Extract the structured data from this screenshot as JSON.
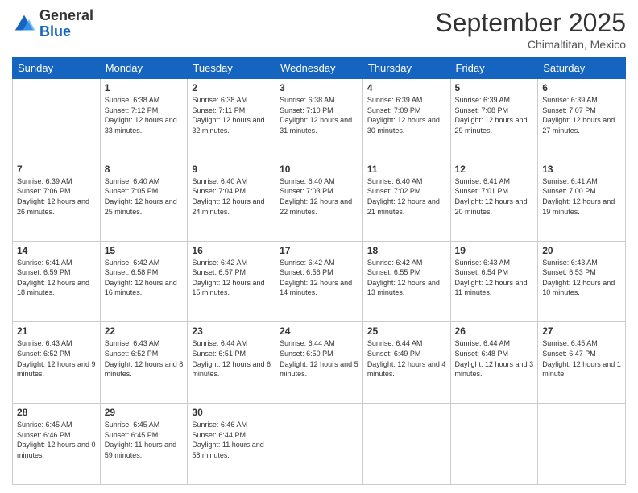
{
  "logo": {
    "general": "General",
    "blue": "Blue"
  },
  "header": {
    "month": "September 2025",
    "location": "Chimaltitan, Mexico"
  },
  "weekdays": [
    "Sunday",
    "Monday",
    "Tuesday",
    "Wednesday",
    "Thursday",
    "Friday",
    "Saturday"
  ],
  "weeks": [
    [
      {
        "day": "",
        "sunrise": "",
        "sunset": "",
        "daylight": ""
      },
      {
        "day": "1",
        "sunrise": "Sunrise: 6:38 AM",
        "sunset": "Sunset: 7:12 PM",
        "daylight": "Daylight: 12 hours and 33 minutes."
      },
      {
        "day": "2",
        "sunrise": "Sunrise: 6:38 AM",
        "sunset": "Sunset: 7:11 PM",
        "daylight": "Daylight: 12 hours and 32 minutes."
      },
      {
        "day": "3",
        "sunrise": "Sunrise: 6:38 AM",
        "sunset": "Sunset: 7:10 PM",
        "daylight": "Daylight: 12 hours and 31 minutes."
      },
      {
        "day": "4",
        "sunrise": "Sunrise: 6:39 AM",
        "sunset": "Sunset: 7:09 PM",
        "daylight": "Daylight: 12 hours and 30 minutes."
      },
      {
        "day": "5",
        "sunrise": "Sunrise: 6:39 AM",
        "sunset": "Sunset: 7:08 PM",
        "daylight": "Daylight: 12 hours and 29 minutes."
      },
      {
        "day": "6",
        "sunrise": "Sunrise: 6:39 AM",
        "sunset": "Sunset: 7:07 PM",
        "daylight": "Daylight: 12 hours and 27 minutes."
      }
    ],
    [
      {
        "day": "7",
        "sunrise": "Sunrise: 6:39 AM",
        "sunset": "Sunset: 7:06 PM",
        "daylight": "Daylight: 12 hours and 26 minutes."
      },
      {
        "day": "8",
        "sunrise": "Sunrise: 6:40 AM",
        "sunset": "Sunset: 7:05 PM",
        "daylight": "Daylight: 12 hours and 25 minutes."
      },
      {
        "day": "9",
        "sunrise": "Sunrise: 6:40 AM",
        "sunset": "Sunset: 7:04 PM",
        "daylight": "Daylight: 12 hours and 24 minutes."
      },
      {
        "day": "10",
        "sunrise": "Sunrise: 6:40 AM",
        "sunset": "Sunset: 7:03 PM",
        "daylight": "Daylight: 12 hours and 22 minutes."
      },
      {
        "day": "11",
        "sunrise": "Sunrise: 6:40 AM",
        "sunset": "Sunset: 7:02 PM",
        "daylight": "Daylight: 12 hours and 21 minutes."
      },
      {
        "day": "12",
        "sunrise": "Sunrise: 6:41 AM",
        "sunset": "Sunset: 7:01 PM",
        "daylight": "Daylight: 12 hours and 20 minutes."
      },
      {
        "day": "13",
        "sunrise": "Sunrise: 6:41 AM",
        "sunset": "Sunset: 7:00 PM",
        "daylight": "Daylight: 12 hours and 19 minutes."
      }
    ],
    [
      {
        "day": "14",
        "sunrise": "Sunrise: 6:41 AM",
        "sunset": "Sunset: 6:59 PM",
        "daylight": "Daylight: 12 hours and 18 minutes."
      },
      {
        "day": "15",
        "sunrise": "Sunrise: 6:42 AM",
        "sunset": "Sunset: 6:58 PM",
        "daylight": "Daylight: 12 hours and 16 minutes."
      },
      {
        "day": "16",
        "sunrise": "Sunrise: 6:42 AM",
        "sunset": "Sunset: 6:57 PM",
        "daylight": "Daylight: 12 hours and 15 minutes."
      },
      {
        "day": "17",
        "sunrise": "Sunrise: 6:42 AM",
        "sunset": "Sunset: 6:56 PM",
        "daylight": "Daylight: 12 hours and 14 minutes."
      },
      {
        "day": "18",
        "sunrise": "Sunrise: 6:42 AM",
        "sunset": "Sunset: 6:55 PM",
        "daylight": "Daylight: 12 hours and 13 minutes."
      },
      {
        "day": "19",
        "sunrise": "Sunrise: 6:43 AM",
        "sunset": "Sunset: 6:54 PM",
        "daylight": "Daylight: 12 hours and 11 minutes."
      },
      {
        "day": "20",
        "sunrise": "Sunrise: 6:43 AM",
        "sunset": "Sunset: 6:53 PM",
        "daylight": "Daylight: 12 hours and 10 minutes."
      }
    ],
    [
      {
        "day": "21",
        "sunrise": "Sunrise: 6:43 AM",
        "sunset": "Sunset: 6:52 PM",
        "daylight": "Daylight: 12 hours and 9 minutes."
      },
      {
        "day": "22",
        "sunrise": "Sunrise: 6:43 AM",
        "sunset": "Sunset: 6:52 PM",
        "daylight": "Daylight: 12 hours and 8 minutes."
      },
      {
        "day": "23",
        "sunrise": "Sunrise: 6:44 AM",
        "sunset": "Sunset: 6:51 PM",
        "daylight": "Daylight: 12 hours and 6 minutes."
      },
      {
        "day": "24",
        "sunrise": "Sunrise: 6:44 AM",
        "sunset": "Sunset: 6:50 PM",
        "daylight": "Daylight: 12 hours and 5 minutes."
      },
      {
        "day": "25",
        "sunrise": "Sunrise: 6:44 AM",
        "sunset": "Sunset: 6:49 PM",
        "daylight": "Daylight: 12 hours and 4 minutes."
      },
      {
        "day": "26",
        "sunrise": "Sunrise: 6:44 AM",
        "sunset": "Sunset: 6:48 PM",
        "daylight": "Daylight: 12 hours and 3 minutes."
      },
      {
        "day": "27",
        "sunrise": "Sunrise: 6:45 AM",
        "sunset": "Sunset: 6:47 PM",
        "daylight": "Daylight: 12 hours and 1 minute."
      }
    ],
    [
      {
        "day": "28",
        "sunrise": "Sunrise: 6:45 AM",
        "sunset": "Sunset: 6:46 PM",
        "daylight": "Daylight: 12 hours and 0 minutes."
      },
      {
        "day": "29",
        "sunrise": "Sunrise: 6:45 AM",
        "sunset": "Sunset: 6:45 PM",
        "daylight": "Daylight: 11 hours and 59 minutes."
      },
      {
        "day": "30",
        "sunrise": "Sunrise: 6:46 AM",
        "sunset": "Sunset: 6:44 PM",
        "daylight": "Daylight: 11 hours and 58 minutes."
      },
      {
        "day": "",
        "sunrise": "",
        "sunset": "",
        "daylight": ""
      },
      {
        "day": "",
        "sunrise": "",
        "sunset": "",
        "daylight": ""
      },
      {
        "day": "",
        "sunrise": "",
        "sunset": "",
        "daylight": ""
      },
      {
        "day": "",
        "sunrise": "",
        "sunset": "",
        "daylight": ""
      }
    ]
  ]
}
